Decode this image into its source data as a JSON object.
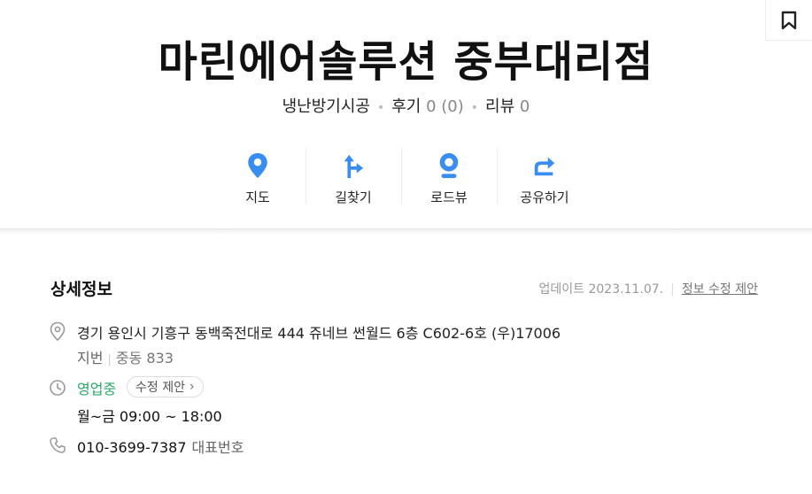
{
  "title": "마린에어솔루션 중부대리점",
  "category": "냉난방기시공",
  "reviews_label": "후기",
  "reviews_value": "0 (0)",
  "blog_label": "리뷰",
  "blog_value": "0",
  "actions": [
    {
      "label": "지도",
      "icon": "map-pin-icon"
    },
    {
      "label": "길찾기",
      "icon": "directions-icon"
    },
    {
      "label": "로드뷰",
      "icon": "roadview-icon"
    },
    {
      "label": "공유하기",
      "icon": "share-icon"
    }
  ],
  "accent_color": "#3a8df0",
  "detail": {
    "title": "상세정보",
    "updated": "업데이트 2023.11.07.",
    "suggest": "정보 수정 제안",
    "address": "경기 용인시 기흥구 동백죽전대로 444 쥬네브 썬월드 6층 C602-6호 (우)17006",
    "jibun_label": "지번",
    "jibun_value": "중동 833",
    "open_status": "영업중",
    "open_chip": "수정 제안",
    "hours": "월~금  09:00 ~ 18:00",
    "phone": "010-3699-7387",
    "phone_type": "대표번호"
  }
}
